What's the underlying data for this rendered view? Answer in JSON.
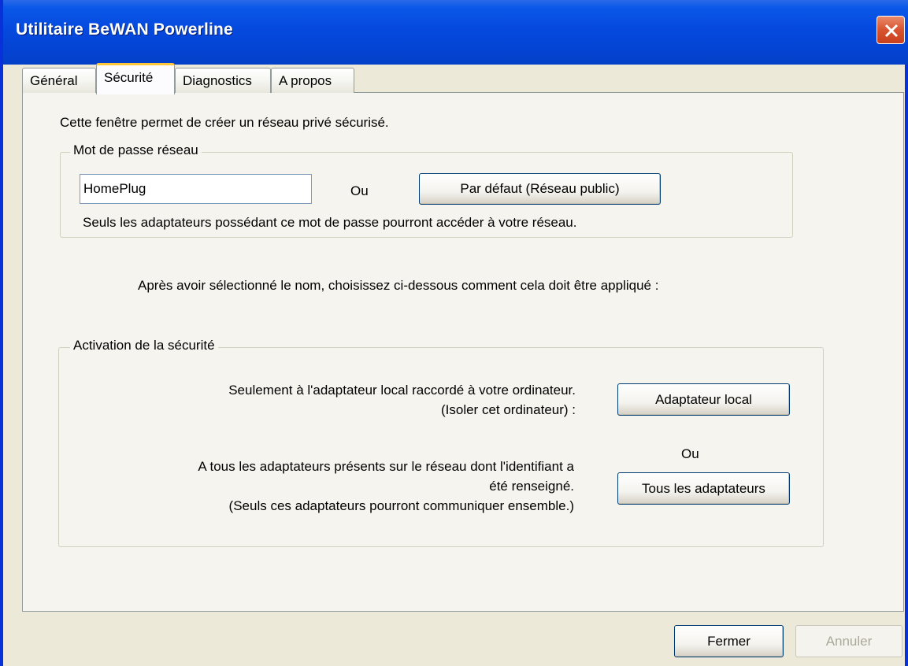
{
  "window": {
    "title": "Utilitaire BeWAN Powerline"
  },
  "tabs": [
    {
      "label": "Général"
    },
    {
      "label": "Sécurité"
    },
    {
      "label": "Diagnostics"
    },
    {
      "label": "A propos"
    }
  ],
  "security": {
    "intro": "Cette fenêtre permet de créer un réseau privé sécurisé.",
    "password_group": {
      "legend": "Mot de passe réseau",
      "password_value": "HomePlug",
      "or_label": "Ou",
      "default_button": "Par défaut (Réseau public)",
      "note": "Seuls les adaptateurs possédant ce mot de passe pourront accéder à votre réseau."
    },
    "instruction": "Après avoir sélectionné le nom, choisissez ci-dessous comment cela doit être appliqué :",
    "activation_group": {
      "legend": "Activation de la sécurité",
      "local_desc_line1": "Seulement à l'adaptateur local raccordé à votre ordinateur.",
      "local_desc_line2": "(Isoler cet ordinateur) :",
      "local_button": "Adaptateur local",
      "or_label": "Ou",
      "all_desc_line1": "A tous les adaptateurs présents sur le réseau dont l'identifiant a",
      "all_desc_line2": "été renseigné.",
      "all_desc_line3": "(Seuls ces adaptateurs pourront communiquer ensemble.)",
      "all_button": "Tous les adaptateurs"
    }
  },
  "footer": {
    "close_button": "Fermer",
    "cancel_button": "Annuler"
  }
}
